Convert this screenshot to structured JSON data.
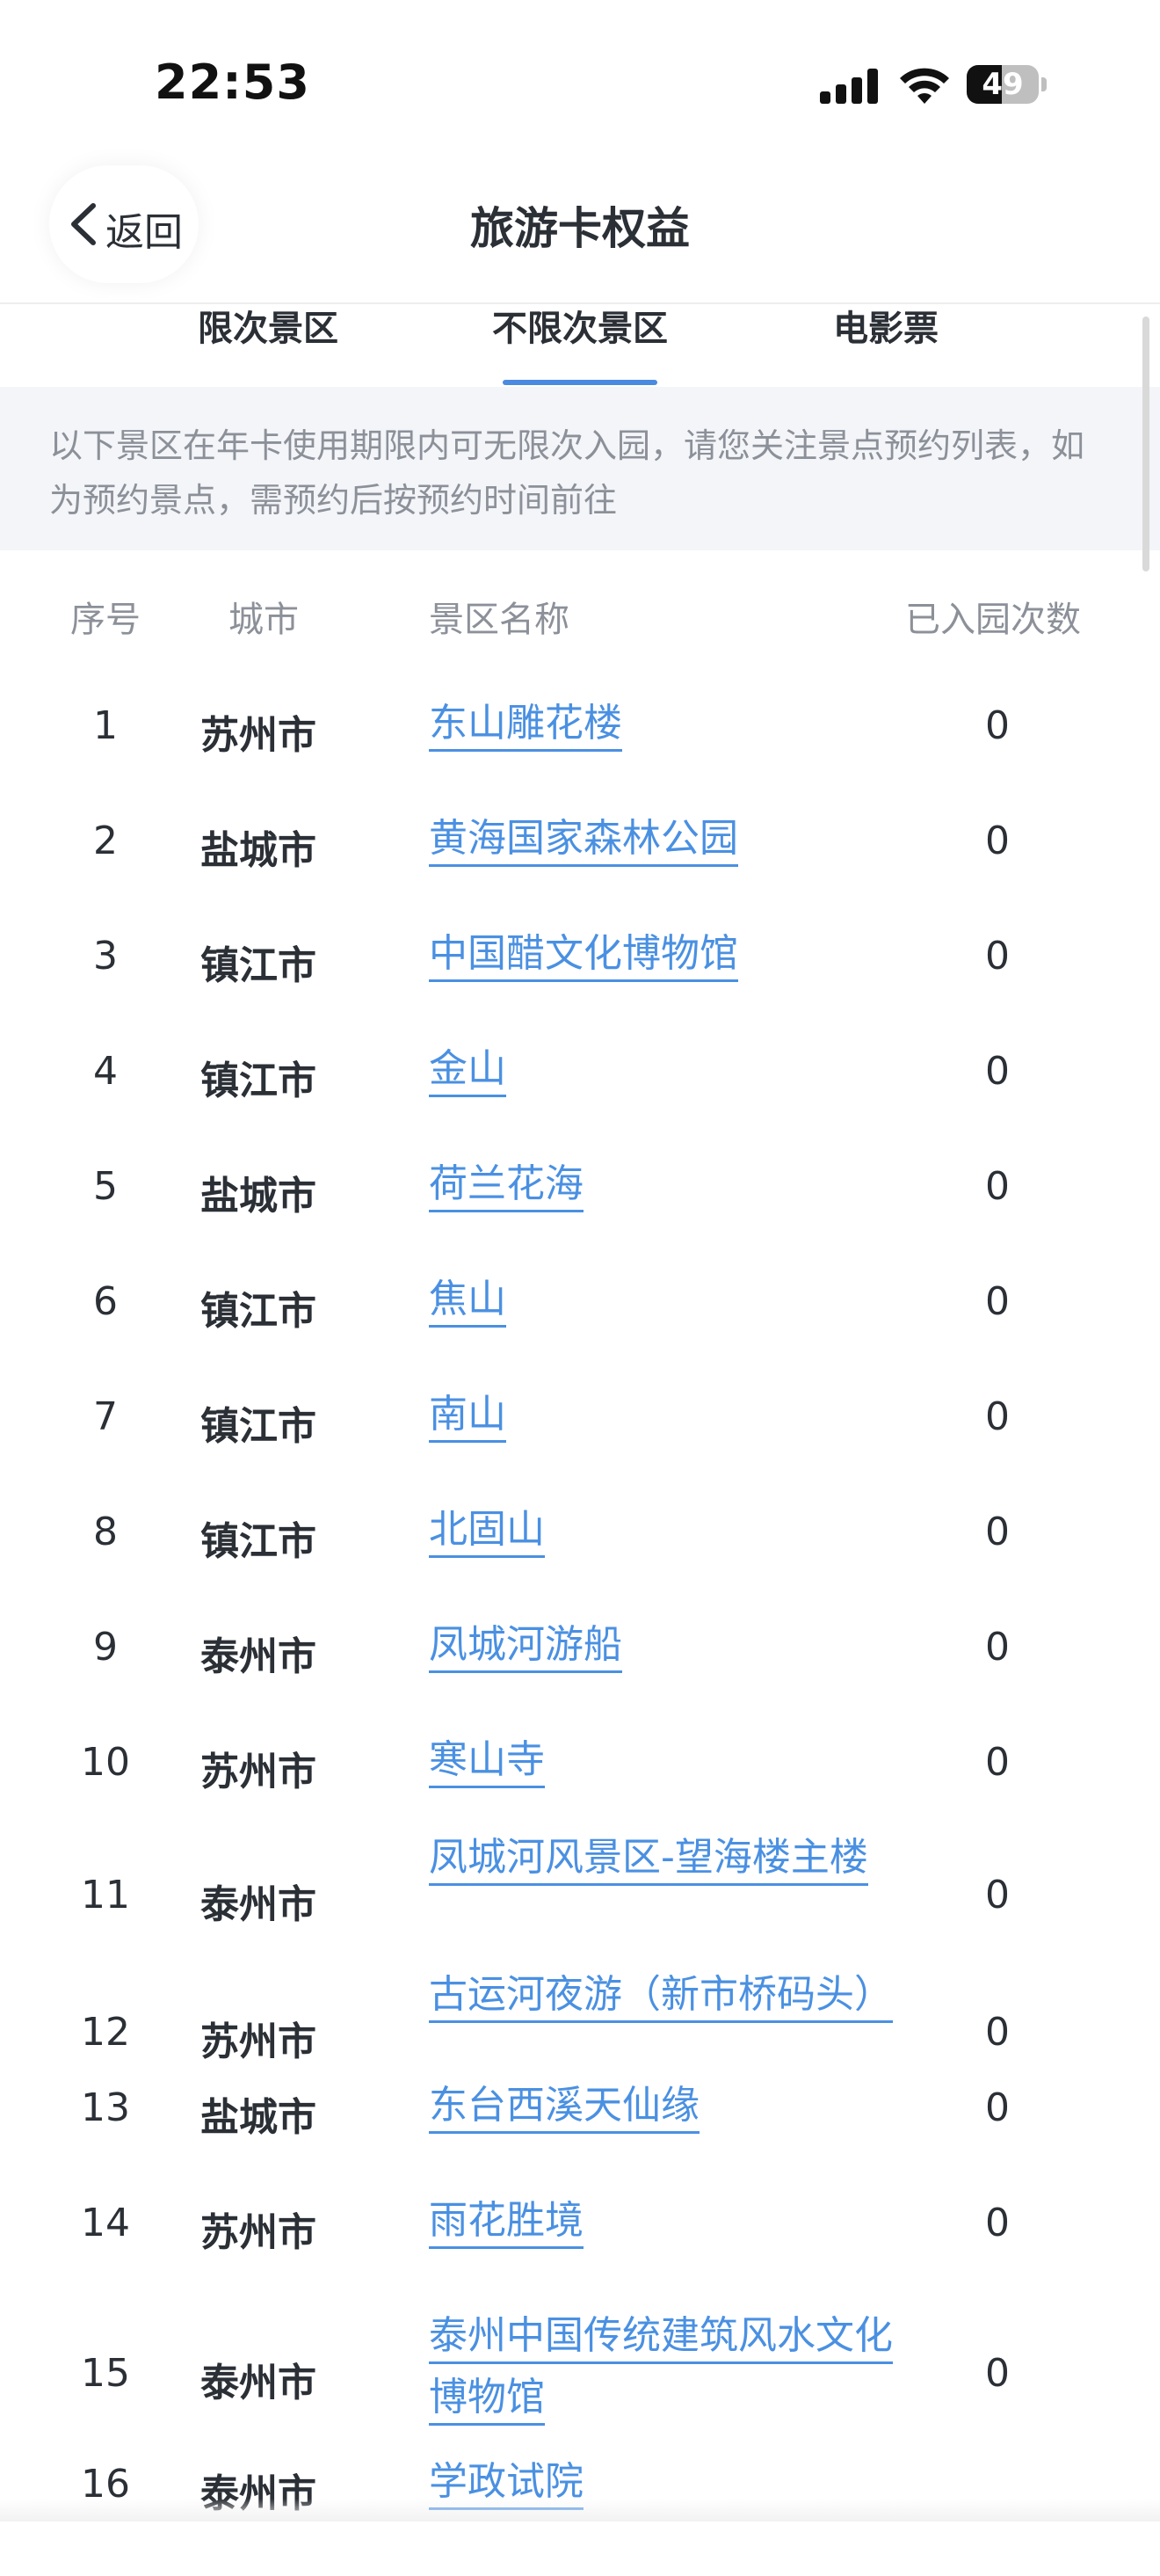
{
  "status_bar": {
    "time": "22:53",
    "battery": "49",
    "battery_level": 0.49
  },
  "nav": {
    "back_label": "返回",
    "title": "旅游卡权益"
  },
  "tabs": [
    {
      "label": "限次景区",
      "selected": false
    },
    {
      "label": "不限次景区",
      "selected": true
    },
    {
      "label": "电影票",
      "selected": false
    }
  ],
  "notice": "以下景区在年卡使用期限内可无限次入园，请您关注景点预约列表，如为预约景点，需预约后按预约时间前往",
  "table": {
    "headers": {
      "index": "序号",
      "city": "城市",
      "name": "景区名称",
      "count": "已入园次数"
    },
    "rows": [
      {
        "index": "1",
        "city": "苏州市",
        "name": "东山雕花楼",
        "count": "0"
      },
      {
        "index": "2",
        "city": "盐城市",
        "name": "黄海国家森林公园",
        "count": "0"
      },
      {
        "index": "3",
        "city": "镇江市",
        "name": "中国醋文化博物馆",
        "count": "0"
      },
      {
        "index": "4",
        "city": "镇江市",
        "name": "金山",
        "count": "0"
      },
      {
        "index": "5",
        "city": "盐城市",
        "name": "荷兰花海",
        "count": "0"
      },
      {
        "index": "6",
        "city": "镇江市",
        "name": "焦山",
        "count": "0"
      },
      {
        "index": "7",
        "city": "镇江市",
        "name": "南山",
        "count": "0"
      },
      {
        "index": "8",
        "city": "镇江市",
        "name": "北固山",
        "count": "0"
      },
      {
        "index": "9",
        "city": "泰州市",
        "name": "凤城河游船",
        "count": "0"
      },
      {
        "index": "10",
        "city": "苏州市",
        "name": "寒山寺",
        "count": "0"
      },
      {
        "index": "11",
        "city": "泰州市",
        "name": "凤城河风景区-望海楼主楼",
        "count": "0"
      },
      {
        "index": "12",
        "city": "苏州市",
        "name": "古运河夜游（新市桥码头）",
        "count": "0"
      },
      {
        "index": "13",
        "city": "盐城市",
        "name": "东台西溪天仙缘",
        "count": "0"
      },
      {
        "index": "14",
        "city": "苏州市",
        "name": "雨花胜境",
        "count": "0"
      },
      {
        "index": "15",
        "city": "泰州市",
        "name": "泰州中国传统建筑风水文化博物馆",
        "count": "0"
      },
      {
        "index": "16",
        "city": "泰州市",
        "name": "学政试院",
        "count": ""
      }
    ]
  },
  "colors": {
    "accent": "#4a8ae0",
    "link": "#4a90e2",
    "notice_bg": "#f3f5f8",
    "muted_text": "#8c9099"
  }
}
